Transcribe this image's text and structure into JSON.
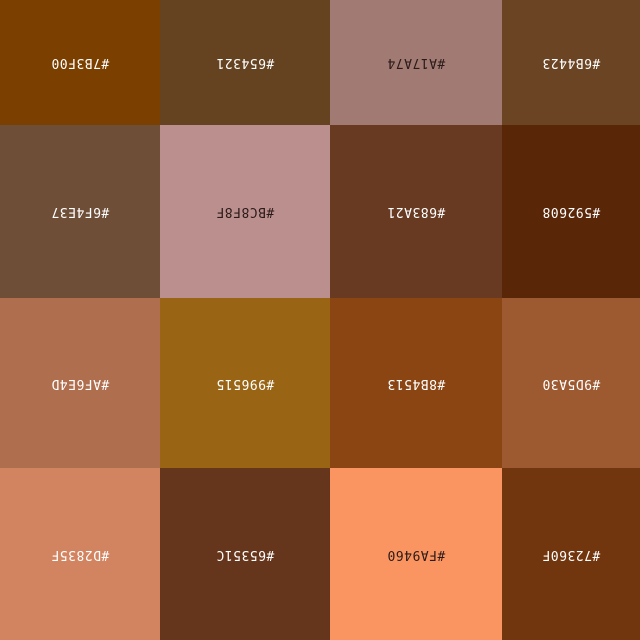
{
  "palette": {
    "rows": [
      [
        {
          "label": "#7B3F00",
          "color": "#7B3F00",
          "text_color": "#FFFFFF"
        },
        {
          "label": "#654321",
          "color": "#654321",
          "text_color": "#FFFFFF"
        },
        {
          "label": "#A17A74",
          "color": "#A17A74",
          "text_color": "#2B1B18"
        },
        {
          "label": "#6B4423",
          "color": "#6B4423",
          "text_color": "#FFFFFF"
        }
      ],
      [
        {
          "label": "#6F4E37",
          "color": "#6F4E37",
          "text_color": "#FFFFFF"
        },
        {
          "label": "#BC8F8F",
          "color": "#BC8F8F",
          "text_color": "#2B1B18"
        },
        {
          "label": "#683A21",
          "color": "#683A21",
          "text_color": "#FFFFFF"
        },
        {
          "label": "#592608",
          "color": "#592608",
          "text_color": "#FFFFFF"
        }
      ],
      [
        {
          "label": "#AF6E4D",
          "color": "#AF6E4D",
          "text_color": "#FFFFFF"
        },
        {
          "label": "#996515",
          "color": "#996515",
          "text_color": "#FFFFFF"
        },
        {
          "label": "#8B4513",
          "color": "#8B4513",
          "text_color": "#FFFFFF"
        },
        {
          "label": "#9D5A30",
          "color": "#9D5A30",
          "text_color": "#FFFFFF"
        }
      ],
      [
        {
          "label": "#D2835F",
          "color": "#D2835F",
          "text_color": "#FFFFFF"
        },
        {
          "label": "#65351C",
          "color": "#65351C",
          "text_color": "#FFFFFF"
        },
        {
          "label": "#FA9460",
          "color": "#FA9460",
          "text_color": "#2B1B18"
        },
        {
          "label": "#72360F",
          "color": "#72360F",
          "text_color": "#FFFFFF"
        }
      ]
    ]
  }
}
